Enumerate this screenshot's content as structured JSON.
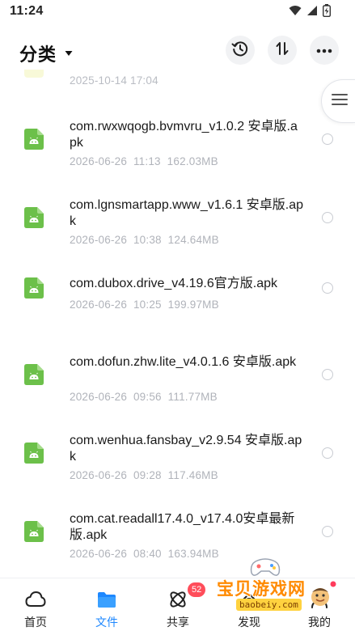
{
  "status_bar": {
    "time": "11:24"
  },
  "header": {
    "title": "分类"
  },
  "partial_item": {
    "date": "2025-10-14  17:04"
  },
  "files": [
    {
      "name": "com.rwxwqogb.bvmvru_v1.0.2 安卓版.apk",
      "date": "2026-06-26",
      "time": "11:13",
      "size": "162.03MB"
    },
    {
      "name": "com.lgnsmartapp.www_v1.6.1 安卓版.apk",
      "date": "2026-06-26",
      "time": "10:38",
      "size": "124.64MB"
    },
    {
      "name": "com.dubox.drive_v4.19.6官方版.apk",
      "date": "2026-06-26",
      "time": "10:25",
      "size": "199.97MB"
    },
    {
      "name": "com.dofun.zhw.lite_v4.0.1.6 安卓版.apk",
      "date": "2026-06-26",
      "time": "09:56",
      "size": "111.77MB"
    },
    {
      "name": "com.wenhua.fansbay_v2.9.54 安卓版.apk",
      "date": "2026-06-26",
      "time": "09:28",
      "size": "117.46MB"
    },
    {
      "name": "com.cat.readall17.4.0_v17.4.0安卓最新版.apk",
      "date": "2026-06-26",
      "time": "08:40",
      "size": "163.94MB"
    }
  ],
  "tabs": [
    {
      "label": "首页",
      "icon": "cloud-icon"
    },
    {
      "label": "文件",
      "icon": "folder-icon",
      "active": true
    },
    {
      "label": "共享",
      "icon": "share-icon",
      "badge": "52"
    },
    {
      "label": "发现",
      "icon": "discover-icon"
    },
    {
      "label": "我的",
      "icon": "user-icon"
    }
  ],
  "watermark": {
    "text": "宝贝游戏网",
    "url": "baobeiy.com"
  },
  "colors": {
    "accent": "#1e88ff",
    "apk_green": "#6cc04a",
    "badge": "#ff4d5a"
  }
}
